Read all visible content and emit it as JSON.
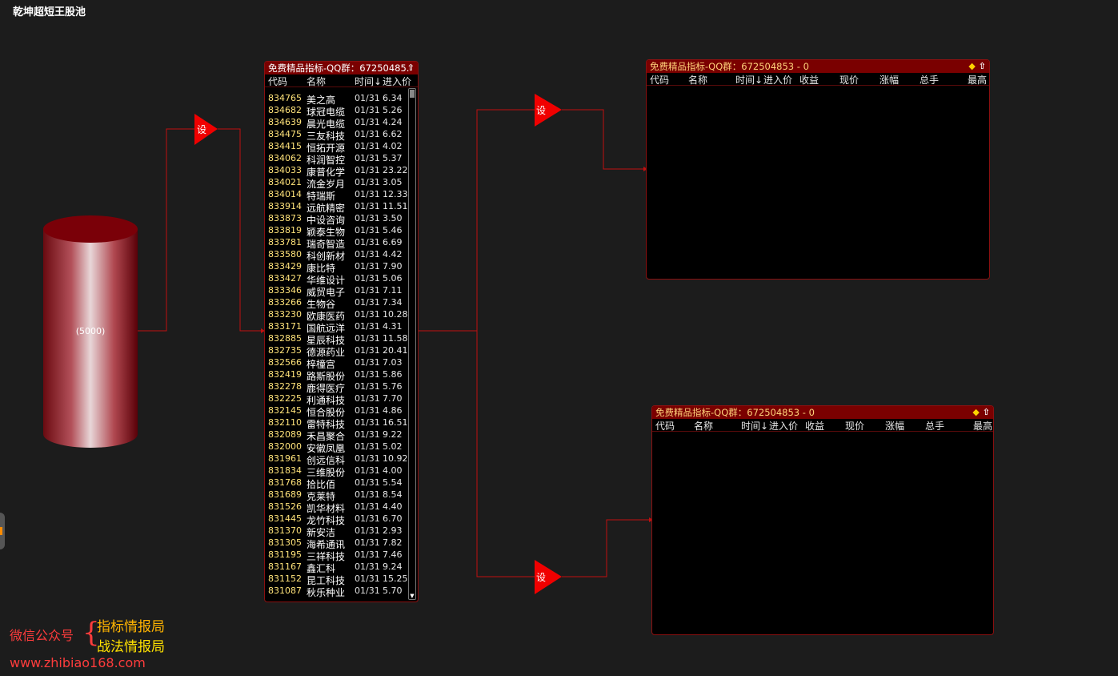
{
  "window": {
    "title": "乾坤超短王股池"
  },
  "pool": {
    "count_label": "(5000)"
  },
  "set_label": "设",
  "main_panel": {
    "title_prefix": "免费精品指标-QQ群：",
    "title_number": "67250485.",
    "columns": {
      "code": "代码",
      "name": "名称",
      "time": "时间↓",
      "price": "进入价"
    },
    "rows": [
      [
        "834765",
        "美之高",
        "01/31",
        "6.34"
      ],
      [
        "834682",
        "球冠电缆",
        "01/31",
        "5.26"
      ],
      [
        "834639",
        "晨光电缆",
        "01/31",
        "4.24"
      ],
      [
        "834475",
        "三友科技",
        "01/31",
        "6.62"
      ],
      [
        "834415",
        "恒拓开源",
        "01/31",
        "4.02"
      ],
      [
        "834062",
        "科润智控",
        "01/31",
        "5.37"
      ],
      [
        "834033",
        "康普化学",
        "01/31",
        "23.22"
      ],
      [
        "834021",
        "流金岁月",
        "01/31",
        "3.05"
      ],
      [
        "834014",
        "特瑞斯",
        "01/31",
        "12.33"
      ],
      [
        "833914",
        "远航精密",
        "01/31",
        "11.51"
      ],
      [
        "833873",
        "中设咨询",
        "01/31",
        "3.50"
      ],
      [
        "833819",
        "颖泰生物",
        "01/31",
        "5.46"
      ],
      [
        "833781",
        "瑞奇智造",
        "01/31",
        "6.69"
      ],
      [
        "833580",
        "科创新材",
        "01/31",
        "4.42"
      ],
      [
        "833429",
        "康比特",
        "01/31",
        "7.90"
      ],
      [
        "833427",
        "华维设计",
        "01/31",
        "5.06"
      ],
      [
        "833346",
        "威贸电子",
        "01/31",
        "7.11"
      ],
      [
        "833266",
        "生物谷",
        "01/31",
        "7.34"
      ],
      [
        "833230",
        "欧康医药",
        "01/31",
        "10.28"
      ],
      [
        "833171",
        "国航远洋",
        "01/31",
        "4.31"
      ],
      [
        "832885",
        "星辰科技",
        "01/31",
        "11.58"
      ],
      [
        "832735",
        "德源药业",
        "01/31",
        "20.41"
      ],
      [
        "832566",
        "梓橦宫",
        "01/31",
        "7.03"
      ],
      [
        "832419",
        "路斯股份",
        "01/31",
        "5.86"
      ],
      [
        "832278",
        "鹿得医疗",
        "01/31",
        "5.76"
      ],
      [
        "832225",
        "利通科技",
        "01/31",
        "7.70"
      ],
      [
        "832145",
        "恒合股份",
        "01/31",
        "4.86"
      ],
      [
        "832110",
        "雷特科技",
        "01/31",
        "16.51"
      ],
      [
        "832089",
        "禾昌聚合",
        "01/31",
        "9.22"
      ],
      [
        "832000",
        "安徽凤凰",
        "01/31",
        "5.02"
      ],
      [
        "831961",
        "创远信科",
        "01/31",
        "10.92"
      ],
      [
        "831834",
        "三维股份",
        "01/31",
        "4.00"
      ],
      [
        "831768",
        "拾比佰",
        "01/31",
        "5.54"
      ],
      [
        "831689",
        "克莱特",
        "01/31",
        "8.54"
      ],
      [
        "831526",
        "凯华材料",
        "01/31",
        "4.40"
      ],
      [
        "831445",
        "龙竹科技",
        "01/31",
        "6.70"
      ],
      [
        "831370",
        "新安洁",
        "01/31",
        "2.93"
      ],
      [
        "831305",
        "海希通讯",
        "01/31",
        "7.82"
      ],
      [
        "831195",
        "三祥科技",
        "01/31",
        "7.46"
      ],
      [
        "831167",
        "鑫汇科",
        "01/31",
        "9.24"
      ],
      [
        "831152",
        "昆工科技",
        "01/31",
        "15.25"
      ],
      [
        "831087",
        "秋乐种业",
        "01/31",
        "5.70"
      ]
    ]
  },
  "side_panel_top": {
    "title_prefix": "免费精品指标-QQ群：",
    "title_number": "672504853 - 0",
    "columns": [
      "代码",
      "名称",
      "时间↓",
      "进入价",
      "收益",
      "现价",
      "涨幅",
      "总手",
      "最高"
    ]
  },
  "side_panel_bottom": {
    "title_prefix": "免费精品指标-QQ群：",
    "title_number": "672504853 - 0",
    "columns": [
      "代码",
      "名称",
      "时间↓",
      "进入价",
      "收益",
      "现价",
      "涨幅",
      "总手",
      "最高"
    ]
  },
  "footer": {
    "wechat_label": "微信公众号",
    "brace": "{",
    "line1": "指标情报局",
    "line2": "战法情报局",
    "url": "www.zhibiao168.com"
  },
  "colors": {
    "accent": "#e00000",
    "panel_title_bg": "#7a0000",
    "code": "#ffe37a"
  }
}
